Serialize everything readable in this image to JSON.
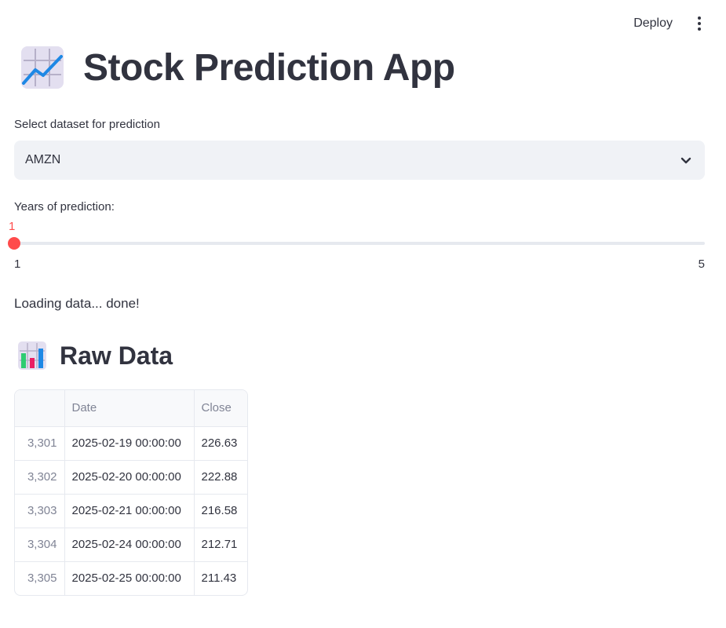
{
  "toolbar": {
    "deploy_label": "Deploy",
    "menu_icon": "more-vertical-icon"
  },
  "header": {
    "title": "Stock Prediction App",
    "icon": "chart-increasing-icon"
  },
  "dataset_select": {
    "label": "Select dataset for prediction",
    "value": "AMZN",
    "icon": "chevron-down-icon"
  },
  "years_slider": {
    "label": "Years of prediction:",
    "current": "1",
    "min": "1",
    "max": "5",
    "value_fraction": 0
  },
  "status": {
    "text": "Loading data... done!"
  },
  "raw_data": {
    "title": "Raw Data",
    "icon": "bar-chart-icon",
    "columns": [
      "",
      "Date",
      "Close"
    ],
    "rows": [
      {
        "index": "3,301",
        "date": "2025-02-19 00:00:00",
        "close": "226.63"
      },
      {
        "index": "3,302",
        "date": "2025-02-20 00:00:00",
        "close": "222.88"
      },
      {
        "index": "3,303",
        "date": "2025-02-21 00:00:00",
        "close": "216.58"
      },
      {
        "index": "3,304",
        "date": "2025-02-24 00:00:00",
        "close": "212.71"
      },
      {
        "index": "3,305",
        "date": "2025-02-25 00:00:00",
        "close": "211.43"
      }
    ]
  },
  "colors": {
    "accent": "#ff4b4b",
    "text": "#31333f",
    "muted": "#808495",
    "input_bg": "#f0f2f6"
  }
}
